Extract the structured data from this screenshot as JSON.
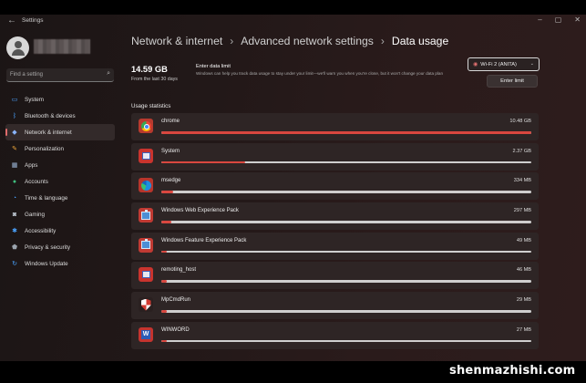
{
  "window": {
    "title": "Settings",
    "back_glyph": "←",
    "controls": [
      "–",
      "▢",
      "✕"
    ]
  },
  "sidebar": {
    "search_placeholder": "Find a setting",
    "items": [
      {
        "label": "System",
        "icon": "monitor-icon",
        "color": "#4aa3ff",
        "active": false
      },
      {
        "label": "Bluetooth & devices",
        "icon": "bluetooth-icon",
        "color": "#4aa3ff",
        "active": false
      },
      {
        "label": "Network & internet",
        "icon": "network-icon",
        "color": "#8ab4ff",
        "active": true
      },
      {
        "label": "Personalization",
        "icon": "brush-icon",
        "color": "#e8a33b",
        "active": false
      },
      {
        "label": "Apps",
        "icon": "apps-icon",
        "color": "#9db7d9",
        "active": false
      },
      {
        "label": "Accounts",
        "icon": "person-icon",
        "color": "#3fbf7f",
        "active": false
      },
      {
        "label": "Time & language",
        "icon": "globe-clock-icon",
        "color": "#4aa3ff",
        "active": false
      },
      {
        "label": "Gaming",
        "icon": "gamepad-icon",
        "color": "#b9c2cc",
        "active": false
      },
      {
        "label": "Accessibility",
        "icon": "accessibility-icon",
        "color": "#4aa3ff",
        "active": false
      },
      {
        "label": "Privacy & security",
        "icon": "shield-icon",
        "color": "#9aa3ad",
        "active": false
      },
      {
        "label": "Windows Update",
        "icon": "update-icon",
        "color": "#4aa3ff",
        "active": false
      }
    ]
  },
  "breadcrumb": {
    "items": [
      "Network & internet",
      "Advanced network settings",
      "Data usage"
    ],
    "separator": "›"
  },
  "summary": {
    "total": "14.59 GB",
    "period": "From the last 30 days"
  },
  "data_limit": {
    "title": "Enter data limit",
    "description": "Windows can help you track data usage to stay under your limit—we'll warn you when you're close, but it won't change your data plan",
    "button_label": "Enter limit"
  },
  "network_select": {
    "value": "Wi-Fi 2 (ANITA)"
  },
  "usage": {
    "title": "Usage statistics",
    "apps": [
      {
        "name": "chrome",
        "size": "10.48 GB",
        "fraction": 1.0,
        "icon": "chrome-icon"
      },
      {
        "name": "System",
        "size": "2.37 GB",
        "fraction": 0.226,
        "icon": "system-icon"
      },
      {
        "name": "msedge",
        "size": "334 MB",
        "fraction": 0.032,
        "icon": "edge-icon"
      },
      {
        "name": "Windows Web Experience Pack",
        "size": "297 MB",
        "fraction": 0.028,
        "icon": "package-icon"
      },
      {
        "name": "Windows Feature Experience Pack",
        "size": "49 MB",
        "fraction": 0.006,
        "icon": "package-icon"
      },
      {
        "name": "remoting_host",
        "size": "46 MB",
        "fraction": 0.005,
        "icon": "remote-icon"
      },
      {
        "name": "MpCmdRun",
        "size": "29 MB",
        "fraction": 0.003,
        "icon": "defender-icon"
      },
      {
        "name": "WINWORD",
        "size": "27 MB",
        "fraction": 0.003,
        "icon": "word-icon"
      }
    ]
  },
  "watermark": "shenmazhishi.com"
}
